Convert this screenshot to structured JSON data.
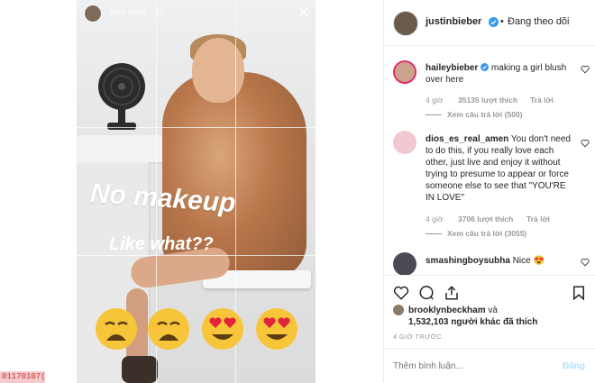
{
  "stamp": "01170107(",
  "story": {
    "title": "Your Story",
    "time": "5h",
    "caption_line1": "No makeup",
    "caption_line2": "Like what??"
  },
  "header": {
    "username": "justinbieber",
    "separator": "•",
    "follow_status": "Đang theo dõi"
  },
  "comments": [
    {
      "username": "haileybieber",
      "text": "making a girl blush over here",
      "time": "4 giờ",
      "likes": "35135 lượt thích",
      "reply": "Trả lời",
      "view_replies": "Xem câu trả lời (500)"
    },
    {
      "username": "dios_es_real_amen",
      "text": "You don't need to do this, if you really love each other, just live and enjoy it without trying to presume to appear or force someone else to see that \"YOU'RE IN LOVE\"",
      "time": "4 giờ",
      "likes": "3706 lượt thích",
      "reply": "Trả lời",
      "view_replies": "Xem câu trả lời (3055)"
    },
    {
      "username": "smashingboysubha",
      "text": "Nice 😍"
    }
  ],
  "likes": {
    "first_user": "brooklynbeckham",
    "and": "và",
    "others": "1,532,103 người khác đã thích"
  },
  "timestamp": "4 GIỜ TRƯỚC",
  "comment_box": {
    "placeholder": "Thêm bình luận...",
    "post_label": "Đăng"
  },
  "colors": {
    "accent": "#3897f0",
    "verified": "#3897f0",
    "text": "#262626",
    "muted": "#999999",
    "post_disabled": "#b2dffc"
  },
  "icons": [
    "close-icon",
    "verified-icon",
    "heart-icon",
    "comment-icon",
    "share-icon",
    "bookmark-icon"
  ]
}
